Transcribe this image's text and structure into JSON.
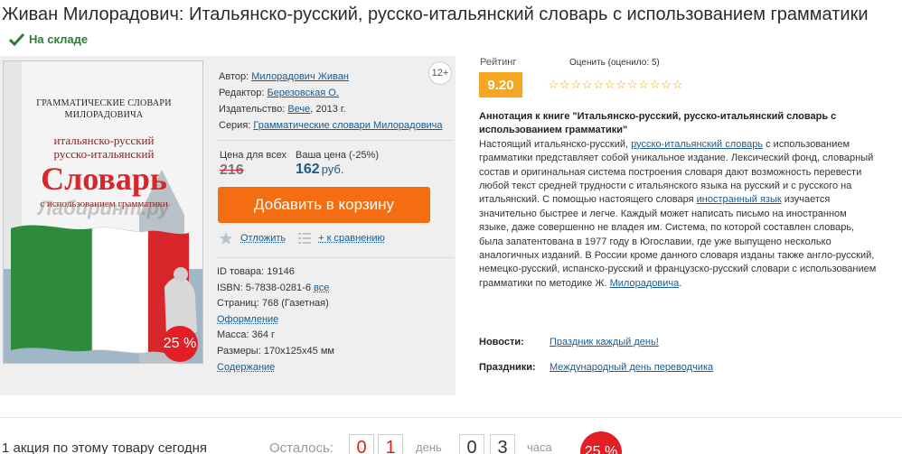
{
  "product": {
    "title": "Живан Милорадович: Итальянско-русский, русско-итальянский словарь с использованием грамматики",
    "stock": "На складе"
  },
  "cover": {
    "series_line1": "ГРАММАТИЧЕСКИЕ СЛОВАРИ",
    "series_line2": "МИЛОРАДОВИЧА",
    "subtitle1": "итальянско-русский",
    "subtitle2": "русско-итальянский",
    "word": "Словарь",
    "tagline": "с использованием грамматики",
    "watermark": "Лабиринт.ру",
    "discount": "25 %",
    "colors": {
      "green": "#2e8b3e",
      "white": "#ffffff",
      "red": "#d9262b"
    }
  },
  "meta": {
    "age": "12+",
    "author_label": "Автор:",
    "author": "Милорадович Живан",
    "editor_label": "Редактор:",
    "editor": "Березовская О.",
    "publisher_label": "Издательство:",
    "publisher": "Вече",
    "year": ", 2013 г.",
    "series_label": "Серия:",
    "series": "Грамматические словари Милорадовича"
  },
  "price": {
    "all_label": "Цена для всех",
    "your_label": "Ваша цена (-25%)",
    "old": "216",
    "new": "162",
    "currency": "руб.",
    "cart_button": "Добавить в корзину",
    "defer": "Отложить",
    "compare": "+ к сравнению"
  },
  "details": {
    "id": "ID товара: 19146",
    "isbn": "ISBN: 5-7838-0281-6",
    "isbn_all": "все",
    "pages": "Страниц: 768 (Газетная)",
    "design": "Оформление",
    "mass": "Масса: 364 г",
    "size": "Размеры: 170x125x45 мм",
    "contents": "Содержание"
  },
  "rating": {
    "label": "Рейтинг",
    "value": "9.20",
    "rate_label": "Оценить (оценило: 5)",
    "stars": 12
  },
  "annotation": {
    "title": "Аннотация к книге \"Итальянско-русский, русско-итальянский словарь с использованием грамматики\"",
    "p1": "Настоящий итальянско-русский, ",
    "link1": "русско-итальянский словарь",
    "p2": " с использованием грамматики представляет собой уникальное издание. Лексический фонд, словарный состав и оригинальная система построения словаря дают возможность перевести любой текст средней трудности с итальянского языка на русский и с русского на итальянский. С помощью настоящего словаря ",
    "link2": "иностранный язык",
    "p3": " изучается значительно быстрее и легче. Каждый может написать письмо на иностранном языке, даже совершенно не владея им. Система, по которой составлен словарь, была запатентована в 1977 году в Югославии, где уже выпущено несколько аналогичных изданий. В России кроме данного словаря изданы также англо-русский, немецко-русский, испанско-русский и французско-русский словари с использованием грамматики по методике Ж. ",
    "link3": "Милорадовича",
    "p4": "."
  },
  "news": {
    "label": "Новости:",
    "link": "Праздник каждый день!"
  },
  "holidays": {
    "label": "Праздники:",
    "link": "Международный день переводчика"
  },
  "promo": {
    "text": "1 акция по этому товару сегодня",
    "left_label": "Осталось:",
    "days": [
      "0",
      "1"
    ],
    "days_label": "день",
    "hours": [
      "0",
      "3"
    ],
    "hours_label": "часа",
    "badge": "25 %"
  }
}
